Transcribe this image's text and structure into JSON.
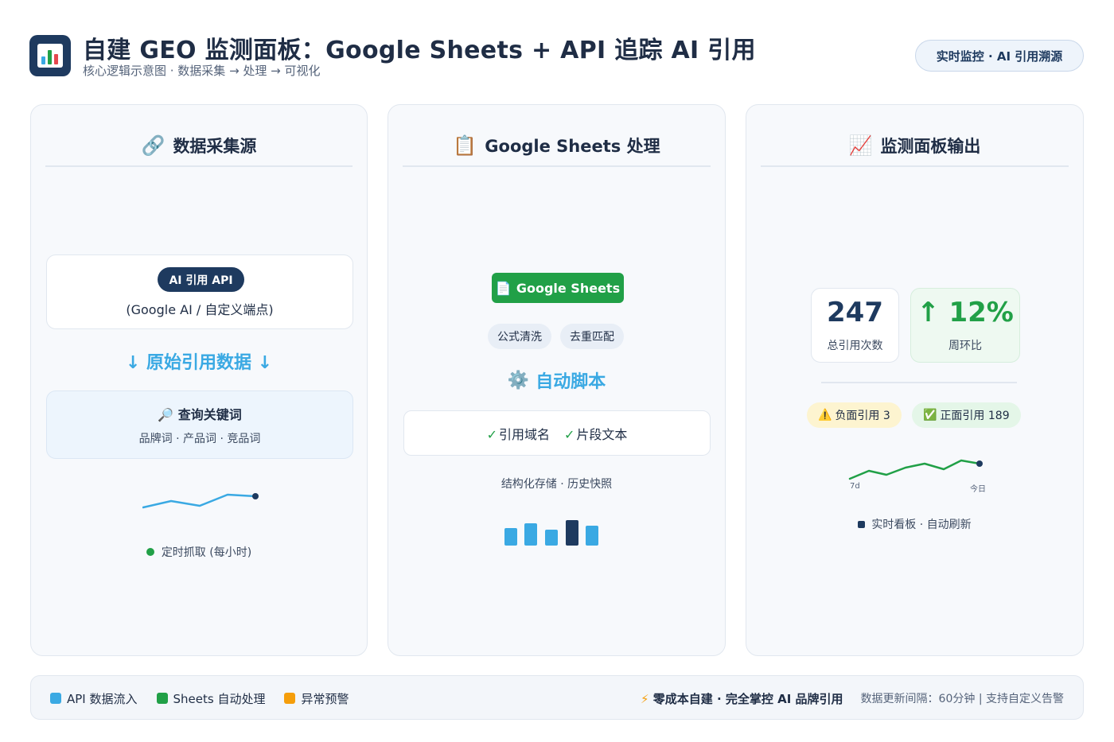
{
  "header": {
    "title": "自建 GEO 监测面板：Google Sheets + API 追踪 AI 引用",
    "subtitle": "核心逻辑示意图 · 数据采集 → 处理 → 可视化",
    "pill": "实时监控 · AI 引用溯源"
  },
  "panel_sources": {
    "title": "数据采集源",
    "icon": "link-icon",
    "api_badge": "AI 引用 API",
    "api_sub": "(Google AI / 自定义端点)",
    "flow_label": "↓ 原始引用数据 ↓",
    "keyword_title": "查询关键词",
    "keyword_icon": "magnifier-icon",
    "keyword_sub": "品牌词 · 产品词 · 竞品词",
    "status": "定时抓取 (每小时)"
  },
  "panel_sheets": {
    "title": "Google Sheets 处理",
    "icon": "clipboard-icon",
    "badge": "Google Sheets",
    "badge_icon": "document-icon",
    "chips": [
      "公式清洗",
      "去重匹配"
    ],
    "script_label": "自动脚本",
    "script_icon": "gear-icon",
    "fields": [
      "引用域名",
      "片段文本"
    ],
    "storage": "结构化存储 · 历史快照"
  },
  "panel_dashboard": {
    "title": "监测面板输出",
    "icon": "chart-up-icon",
    "stat_total": {
      "value": "247",
      "label": "总引用次数"
    },
    "stat_change": {
      "value": "↑ 12%",
      "label": "周环比"
    },
    "negative": "负面引用 3",
    "positive": "正面引用 189",
    "trend_start_label": "7d",
    "trend_end_label": "今日",
    "status": "实时看板 · 自动刷新"
  },
  "footer": {
    "legend": [
      {
        "label": "API 数据流入",
        "color": "#3aa9e3"
      },
      {
        "label": "Sheets 自动处理",
        "color": "#21a047"
      },
      {
        "label": "异常预警",
        "color": "#f59e0b"
      }
    ],
    "slogan": "零成本自建 · 完全掌控 AI 品牌引用",
    "note": "数据更新间隔：60分钟 | 支持自定义告警"
  },
  "colors": {
    "navy": "#1e3a5f",
    "blue": "#3aa9e3",
    "green": "#21a047",
    "amber": "#f59e0b"
  }
}
